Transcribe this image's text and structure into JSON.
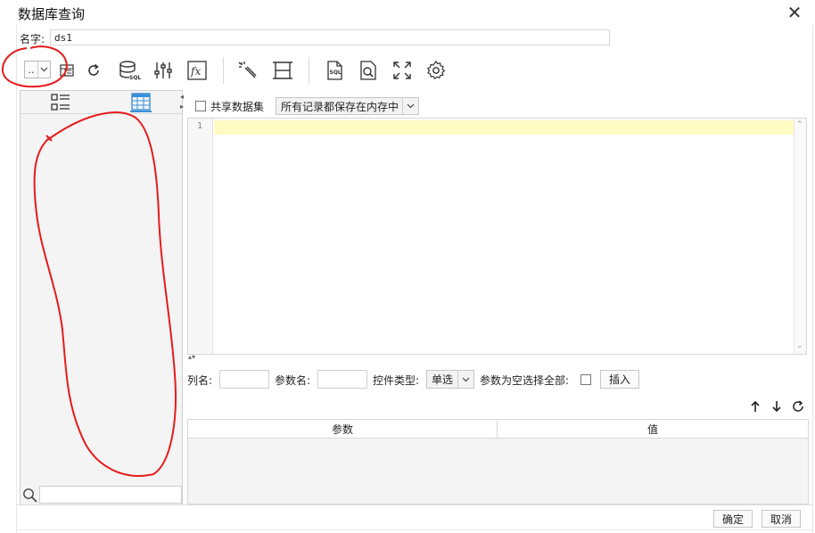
{
  "window": {
    "title": "数据库查询",
    "close_symbol": "✕"
  },
  "name_field": {
    "label": "名字:",
    "value": "ds1"
  },
  "toolbar": {
    "datasource_select": {
      "value": "..",
      "arrow": "⌄"
    },
    "icons": [
      "preview-icon",
      "refresh-icon",
      "database-sql-icon",
      "sliders-icon",
      "formula-icon",
      "magic-wand-icon",
      "column-split-icon",
      "sql-file-icon",
      "search-preview-icon",
      "fullscreen-icon",
      "settings-gear-icon"
    ]
  },
  "left_panel": {
    "tabs": [
      "list-view-icon",
      "table-grid-icon"
    ],
    "active_tab": "table-grid-icon",
    "search_placeholder": ""
  },
  "editor": {
    "share_dataset_label": "共享数据集",
    "storage_select": "所有记录都保存在内存中",
    "line_numbers": [
      "1"
    ],
    "current_line_color": "#fffbc3"
  },
  "params": {
    "column_name_label": "列名:",
    "param_name_label": "参数名:",
    "control_type_label": "控件类型:",
    "control_type_value": "单选",
    "empty_select_all_label": "参数为空选择全部:",
    "insert_button": "插入",
    "table": {
      "columns": [
        "参数",
        "值"
      ],
      "rows": []
    }
  },
  "footer": {
    "ok_button": "确定",
    "cancel_button": "取消"
  },
  "colors": {
    "accent": "#3a8fd8",
    "annotation": "#e51c1c"
  }
}
